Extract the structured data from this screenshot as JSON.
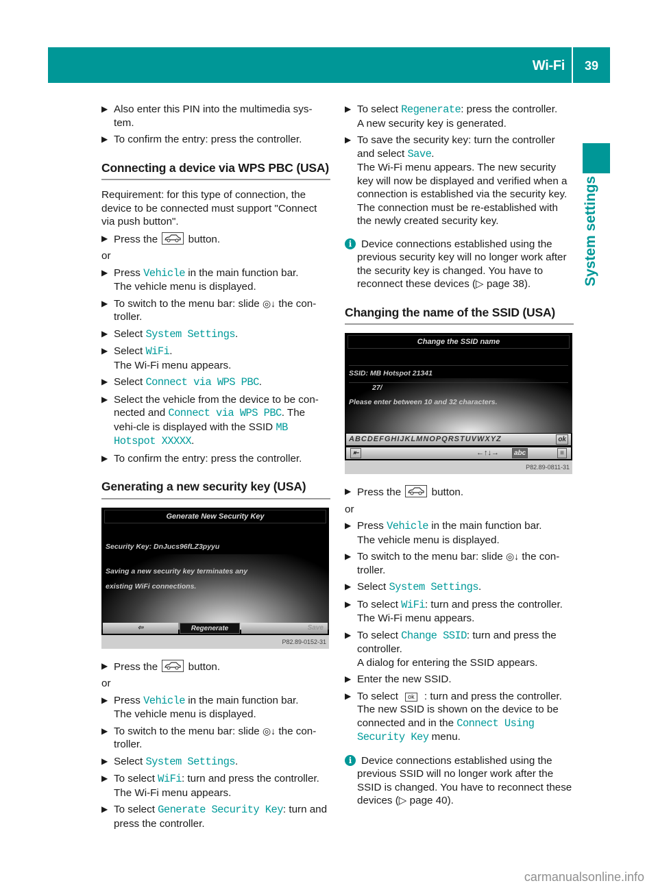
{
  "header": {
    "section_title": "Wi-Fi",
    "page_number": "39"
  },
  "side_tab": {
    "label": "System settings"
  },
  "colors": {
    "accent": "#009797",
    "ui_text": "#009a9a"
  },
  "left_column": {
    "intro_steps": [
      {
        "text": "Also enter this PIN into the multimedia sys-tem."
      },
      {
        "text": "To confirm the entry: press the controller."
      }
    ],
    "wps_section": {
      "heading": "Connecting a device via WPS PBC (USA)",
      "requirement": "Requirement: for this type of connection, the device to be connected must support \"Connect via push button\".",
      "step1_pre": "Press the",
      "step1_post": "button.",
      "or": "or",
      "step2_pre": "Press",
      "step2_ui": "Vehicle",
      "step2_post": "in the main function bar.",
      "step2_result": "The vehicle menu is displayed.",
      "step3_pre": "To switch to the menu bar: slide",
      "step3_post": "the con-troller.",
      "step4_pre": "Select",
      "step4_ui": "System Settings",
      "step4_post": ".",
      "step5_pre": "Select",
      "step5_ui": "WiFi",
      "step5_post": ".",
      "step5_result": "The Wi-Fi menu appears.",
      "step6_pre": "Select",
      "step6_ui": "Connect via WPS PBC",
      "step6_post": ".",
      "step7_pre": "Select the vehicle from the device to be con-nected and",
      "step7_ui": "Connect via WPS PBC",
      "step7_mid": ". The vehi-cle is displayed with the SSID",
      "step7_ui2": "MB Hotspot XXXXX",
      "step7_post": ".",
      "step8": "To confirm the entry: press the controller."
    },
    "security_section": {
      "heading": "Generating a new security key (USA)",
      "screen": {
        "title": "Generate New Security Key",
        "key_line": "Security Key: DnJucs96fLZ3pyyu",
        "warning_line1": "Saving a new security key terminates any",
        "warning_line2": "existing WiFi connections.",
        "back_button": "⇦",
        "regenerate_button": "Regenerate",
        "save_button": "Save",
        "figure_code": "P82.89-0152-31"
      },
      "step1_pre": "Press the",
      "step1_post": "button.",
      "or": "or",
      "step2_pre": "Press",
      "step2_ui": "Vehicle",
      "step2_post": "in the main function bar.",
      "step2_result": "The vehicle menu is displayed.",
      "step3_pre": "To switch to the menu bar: slide",
      "step3_post": "the con-troller.",
      "step4_pre": "Select",
      "step4_ui": "System Settings",
      "step4_post": ".",
      "step5_pre": "To select",
      "step5_ui": "WiFi",
      "step5_post": ": turn and press the controller.",
      "step5_result": "The Wi-Fi menu appears.",
      "step6_pre": "To select",
      "step6_ui": "Generate Security Key",
      "step6_post": ": turn and press the controller."
    }
  },
  "right_column": {
    "security_cont": {
      "step7_pre": "To select",
      "step7_ui": "Regenerate",
      "step7_post": ": press the controller.",
      "step7_result": "A new security key is generated.",
      "step8_pre": "To save the security key: turn the controller and select",
      "step8_ui": "Save",
      "step8_post": ".",
      "step8_result": "The Wi-Fi menu appears. The new security key will now be displayed and verified when a connection is established via the security key. The connection must be re-established with the newly created security key.",
      "info": "Device connections established using the previous security key will no longer work after the security key is changed. You have to reconnect these devices (▷ page 38)."
    },
    "ssid_section": {
      "heading": "Changing the name of the SSID (USA)",
      "screen": {
        "title": "Change the SSID name",
        "ssid_line": "SSID: MB Hotspot 21341",
        "count_line": "27/",
        "hint_line": "Please enter between 10 and 32 characters.",
        "keyboard_letters": "ABCDEFGHIJKLMNOPQRSTUVWXYZ",
        "ok_key": "ok",
        "abc_key": "abc",
        "figure_code": "P82.89-0811-31"
      },
      "step1_pre": "Press the",
      "step1_post": "button.",
      "or": "or",
      "step2_pre": "Press",
      "step2_ui": "Vehicle",
      "step2_post": "in the main function bar.",
      "step2_result": "The vehicle menu is displayed.",
      "step3_pre": "To switch to the menu bar: slide",
      "step3_post": "the con-troller.",
      "step4_pre": "Select",
      "step4_ui": "System Settings",
      "step4_post": ".",
      "step5_pre": "To select",
      "step5_ui": "WiFi",
      "step5_post": ": turn and press the controller.",
      "step5_result": "The Wi-Fi menu appears.",
      "step6_pre": "To select",
      "step6_ui": "Change SSID",
      "step6_post": ": turn and press the controller.",
      "step6_result": "A dialog for entering the SSID appears.",
      "step7": "Enter the new SSID.",
      "step8_pre": "To select",
      "step8_ok": "ok",
      "step8_post": ": turn and press the controller.",
      "step8_result_pre": "The new SSID is shown on the device to be connected and in the",
      "step8_ui": "Connect Using Security Key",
      "step8_result_post": "menu.",
      "info": "Device connections established using the previous SSID will no longer work after the SSID is changed. You have to reconnect these devices (▷ page 40)."
    }
  },
  "footer": {
    "watermark": "carmanualsonline.info"
  }
}
